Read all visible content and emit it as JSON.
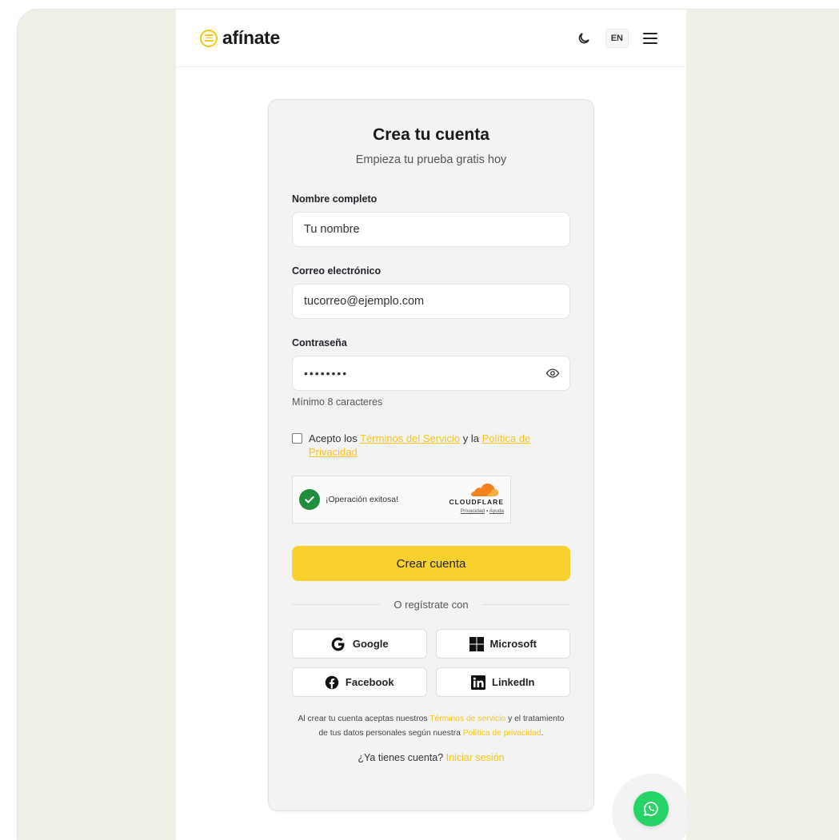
{
  "header": {
    "logo_text": "afínate",
    "lang_label": "EN",
    "icons": [
      "theme-moon-icon",
      "hamburger-menu-icon"
    ]
  },
  "form": {
    "title": "Crea tu cuenta",
    "subtitle": "Empieza tu prueba gratis hoy",
    "name_label": "Nombre completo",
    "name_placeholder": "Tu nombre",
    "email_label": "Correo electrónico",
    "email_placeholder": "tucorreo@ejemplo.com",
    "password_label": "Contraseña",
    "password_value": "••••••••",
    "password_hint": "Mínimo 8 caracteres",
    "terms_prefix": "Acepto los",
    "terms_link": "Términos del Servicio",
    "terms_mid": "y la",
    "privacy_link": "Política de Privacidad",
    "terms_checked": false
  },
  "captcha": {
    "status": "¡Operación exitosa!",
    "brand": "CLOUDFLARE",
    "privacy": "Privacidad",
    "separator": "•",
    "help": "Ayuda"
  },
  "submit_label": "Crear cuenta",
  "divider_text": "O regístrate con",
  "social": [
    {
      "label": "Google",
      "icon": "google-icon"
    },
    {
      "label": "Microsoft",
      "icon": "microsoft-icon"
    },
    {
      "label": "Facebook",
      "icon": "facebook-icon"
    },
    {
      "label": "LinkedIn",
      "icon": "linkedin-icon"
    }
  ],
  "legal": {
    "p1": "Al crear tu cuenta aceptas nuestros",
    "terms_link": "Términos de servicio",
    "p2": "y el tratamiento de tus datos personales según nuestra",
    "privacy_link": "Política de privacidad",
    "p3": "."
  },
  "login_prompt": {
    "text": "¿Ya tienes cuenta?",
    "link": "Iniciar sesión"
  },
  "colors": {
    "accent": "#f8d12f",
    "link": "#f5c518",
    "whatsapp": "#25d366",
    "success": "#1e8e3e"
  }
}
